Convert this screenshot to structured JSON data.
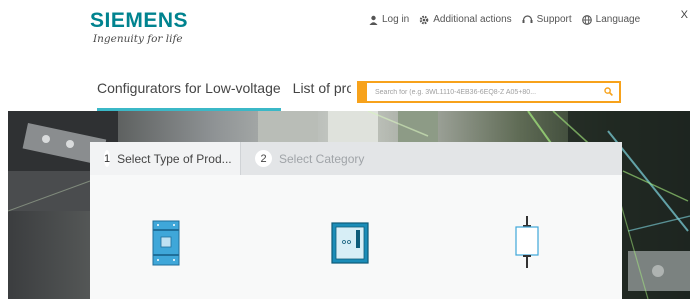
{
  "header": {
    "logo_name": "SIEMENS",
    "logo_tagline": "Ingenuity for life",
    "actions": [
      {
        "label": "Log in",
        "icon": "user-icon"
      },
      {
        "label": "Additional actions",
        "icon": "gear-icon"
      },
      {
        "label": "Support",
        "icon": "headset-icon"
      },
      {
        "label": "Language",
        "icon": "globe-icon"
      }
    ],
    "close_label": "X"
  },
  "nav": {
    "tabs": [
      {
        "label": "Configurators for Low-voltage",
        "active": true
      },
      {
        "label": "List of products",
        "active": false
      }
    ]
  },
  "search": {
    "placeholder": "Search for (e.g. 3WL1110-4EB36-6EQ8-Z A05+80...",
    "icon": "search-icon"
  },
  "wizard": {
    "steps": [
      {
        "number": "1",
        "label": "Select Type of Prod...",
        "active": true
      },
      {
        "number": "2",
        "label": "Select Category",
        "active": false
      }
    ],
    "product_icons": [
      "molded-case-breaker-icon",
      "air-circuit-breaker-icon",
      "fuse-switch-icon"
    ]
  },
  "colors": {
    "brand": "#00838f",
    "accent": "#3bb8c7",
    "search_border": "#f7a21b"
  }
}
